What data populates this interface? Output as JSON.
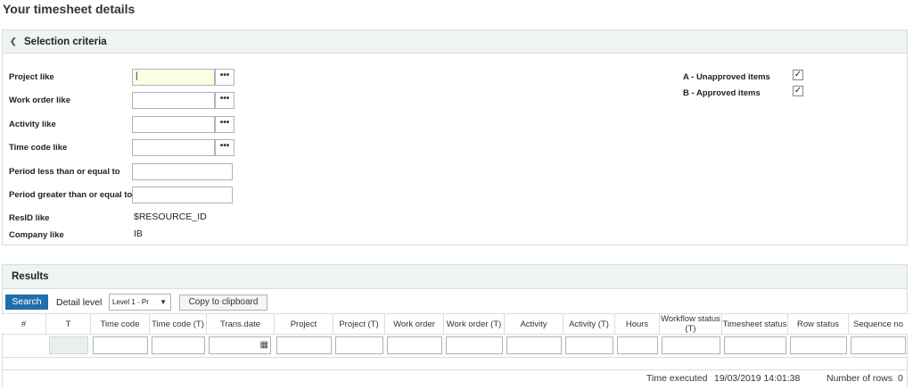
{
  "page_title": "Your timesheet details",
  "selection": {
    "header": "Selection criteria",
    "fields": [
      {
        "label": "Project like",
        "value": "|"
      },
      {
        "label": "Work order like",
        "value": ""
      },
      {
        "label": "Activity like",
        "value": ""
      },
      {
        "label": "Time code like",
        "value": ""
      },
      {
        "label": "Period less than or equal to",
        "value": ""
      },
      {
        "label": "Period greater than or equal to",
        "value": ""
      }
    ],
    "dots": "•••",
    "resid_label": "ResID like",
    "resid_value": "$RESOURCE_ID",
    "company_label": "Company like",
    "company_value": "IB",
    "checks": [
      {
        "label": "A - Unapproved items",
        "mark": "✓"
      },
      {
        "label": "B - Approved items",
        "mark": "✓"
      }
    ]
  },
  "results": {
    "header": "Results",
    "search_label": "Search",
    "detail_label": "Detail level",
    "detail_value": "Level 1 - Pr",
    "copy_label": "Copy to clipboard",
    "columns": [
      "#",
      "T",
      "Time code",
      "Time code (T)",
      "Trans.date",
      "Project",
      "Project (T)",
      "Work order",
      "Work order (T)",
      "Activity",
      "Activity (T)",
      "Hours",
      "Workflow status (T)",
      "Timesheet status",
      "Row status",
      "Sequence no"
    ],
    "time_executed_label": "Time executed",
    "time_executed_value": "19/03/2019 14:01:38",
    "rows_label": "Number of rows",
    "rows_value": "0"
  }
}
